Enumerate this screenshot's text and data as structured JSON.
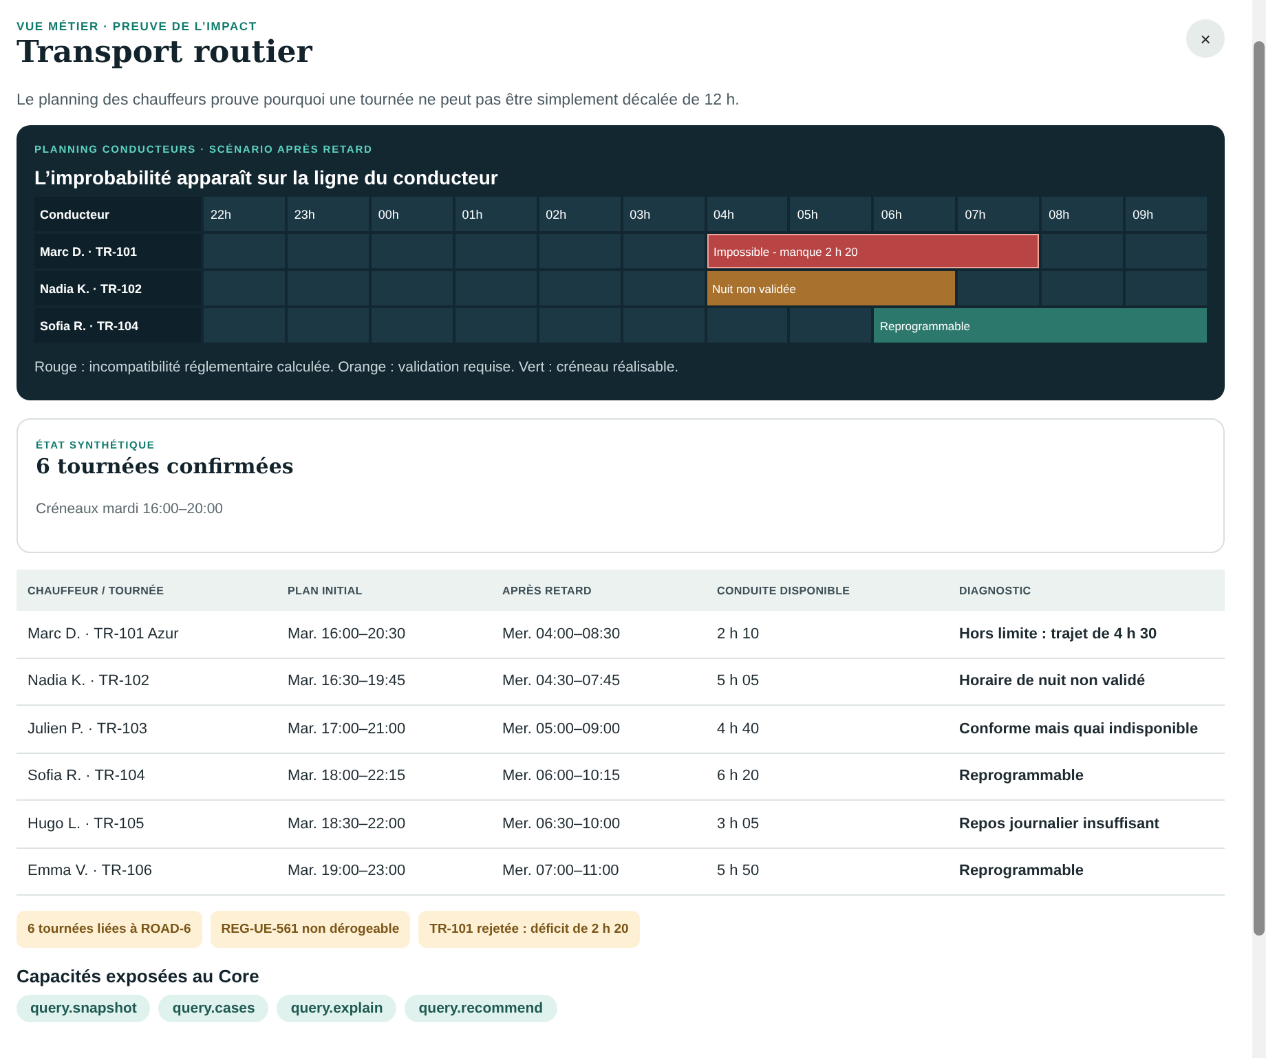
{
  "header": {
    "eyebrow": "VUE MÉTIER · PREUVE DE L’IMPACT",
    "title": "Transport routier",
    "close": "×",
    "description": "Le planning des chauffeurs prouve pourquoi une tournée ne peut pas être simplement décalée de 12 h."
  },
  "planning": {
    "eyebrow": "PLANNING CONDUCTEURS · SCÉNARIO APRÈS RETARD",
    "title": "L’improbabilité apparaît sur la ligne du conducteur",
    "row_header": "Conducteur",
    "hours": [
      "22h",
      "23h",
      "00h",
      "01h",
      "02h",
      "03h",
      "04h",
      "05h",
      "06h",
      "07h",
      "08h",
      "09h"
    ],
    "rows": [
      {
        "driver": "Marc D. · TR-101",
        "bar_label": "Impossible - manque 2 h 20",
        "slots": [
          {
            "kind": "free"
          },
          {
            "kind": "free"
          },
          {
            "kind": "free"
          },
          {
            "kind": "free"
          },
          {
            "kind": "free"
          },
          {
            "kind": "free"
          },
          {
            "kind": "blocked"
          },
          {
            "kind": "blocked"
          },
          {
            "kind": "blocked"
          },
          {
            "kind": "blocked"
          },
          {
            "kind": "free"
          },
          {
            "kind": "free"
          }
        ]
      },
      {
        "driver": "Nadia K. · TR-102",
        "bar_label": "Nuit non validée",
        "slots": [
          {
            "kind": "free"
          },
          {
            "kind": "free"
          },
          {
            "kind": "free"
          },
          {
            "kind": "free"
          },
          {
            "kind": "free"
          },
          {
            "kind": "free"
          },
          {
            "kind": "pending"
          },
          {
            "kind": "pending"
          },
          {
            "kind": "pending"
          },
          {
            "kind": "free"
          },
          {
            "kind": "free"
          },
          {
            "kind": "free"
          }
        ]
      },
      {
        "driver": "Sofia R. · TR-104",
        "bar_label": "Reprogrammable",
        "slots": [
          {
            "kind": "free"
          },
          {
            "kind": "free"
          },
          {
            "kind": "free"
          },
          {
            "kind": "free"
          },
          {
            "kind": "free"
          },
          {
            "kind": "free"
          },
          {
            "kind": "free"
          },
          {
            "kind": "free"
          },
          {
            "kind": "feasible"
          },
          {
            "kind": "feasible"
          },
          {
            "kind": "feasible"
          },
          {
            "kind": "feasible"
          }
        ]
      }
    ],
    "legend": "Rouge : incompatibilité réglementaire calculée. Orange : validation requise. Vert : créneau réalisable."
  },
  "summary": {
    "eyebrow": "ÉTAT SYNTHÉTIQUE",
    "title": "6 tournées confirmées",
    "subtitle": "Créneaux mardi 16:00–20:00"
  },
  "table": {
    "columns": [
      "CHAUFFEUR / TOURNÉE",
      "PLAN INITIAL",
      "APRÈS RETARD",
      "CONDUITE DISPONIBLE",
      "DIAGNOSTIC"
    ],
    "rows": [
      [
        "Marc D. · TR-101 Azur",
        "Mar. 16:00–20:30",
        "Mer. 04:00–08:30",
        "2 h 10",
        "Hors limite : trajet de 4 h 30"
      ],
      [
        "Nadia K. · TR-102",
        "Mar. 16:30–19:45",
        "Mer. 04:30–07:45",
        "5 h 05",
        "Horaire de nuit non validé"
      ],
      [
        "Julien P. · TR-103",
        "Mar. 17:00–21:00",
        "Mer. 05:00–09:00",
        "4 h 40",
        "Conforme mais quai indisponible"
      ],
      [
        "Sofia R. · TR-104",
        "Mar. 18:00–22:15",
        "Mer. 06:00–10:15",
        "6 h 20",
        "Reprogrammable"
      ],
      [
        "Hugo L. · TR-105",
        "Mar. 18:30–22:00",
        "Mer. 06:30–10:00",
        "3 h 05",
        "Repos journalier insuffisant"
      ],
      [
        "Emma V. · TR-106",
        "Mar. 19:00–23:00",
        "Mer. 07:00–11:00",
        "5 h 50",
        "Reprogrammable"
      ]
    ]
  },
  "tags": [
    "6 tournées liées à ROAD-6",
    "REG-UE-561 non dérogeable",
    "TR-101 rejetée : déficit de 2 h 20"
  ],
  "capabilities": {
    "title": "Capacités exposées au Core",
    "items": [
      "query.snapshot",
      "query.cases",
      "query.explain",
      "query.recommend"
    ]
  }
}
